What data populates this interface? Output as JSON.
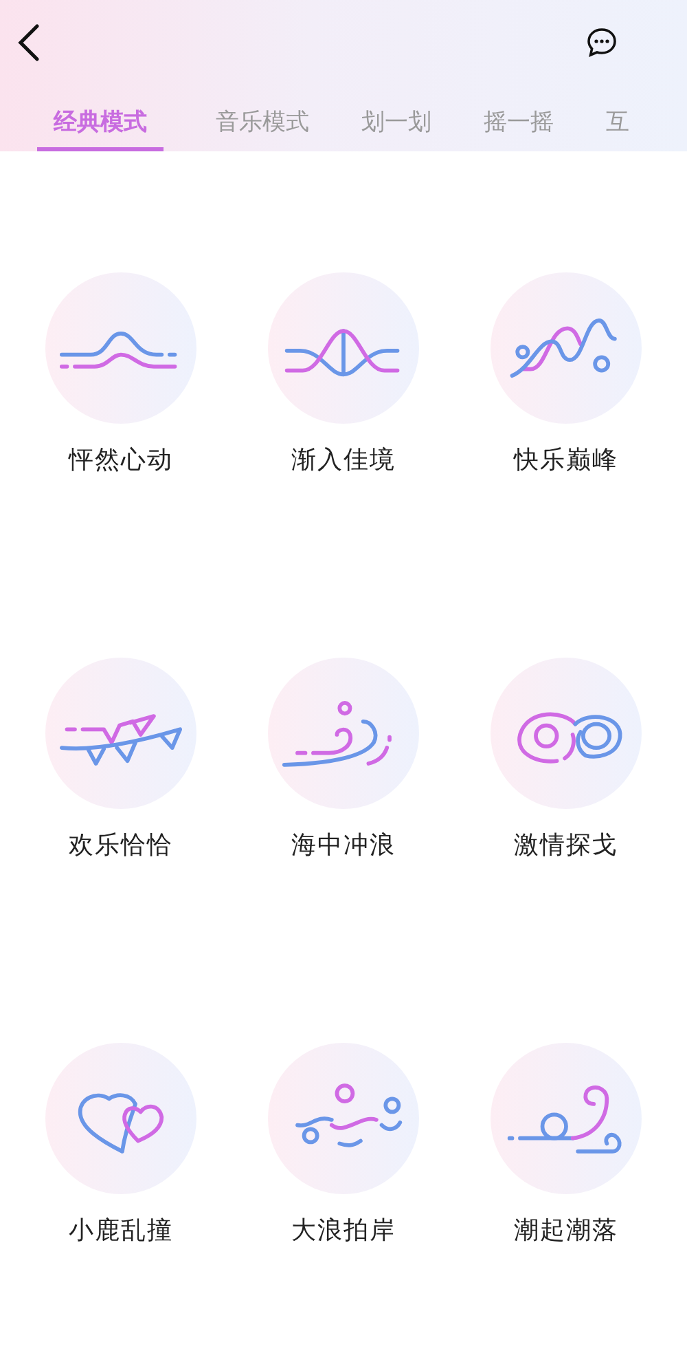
{
  "tabs": [
    {
      "label": "经典模式",
      "selected": true
    },
    {
      "label": "音乐模式",
      "selected": false
    },
    {
      "label": "划一划",
      "selected": false
    },
    {
      "label": "摇一摇",
      "selected": false
    },
    {
      "label": "互",
      "selected": false
    }
  ],
  "modes": [
    {
      "label": "怦然心动"
    },
    {
      "label": "渐入佳境"
    },
    {
      "label": "快乐巅峰"
    },
    {
      "label": "欢乐恰恰"
    },
    {
      "label": "海中冲浪"
    },
    {
      "label": "激情探戈"
    },
    {
      "label": "小鹿乱撞"
    },
    {
      "label": "大浪拍岸"
    },
    {
      "label": "潮起潮落"
    }
  ]
}
